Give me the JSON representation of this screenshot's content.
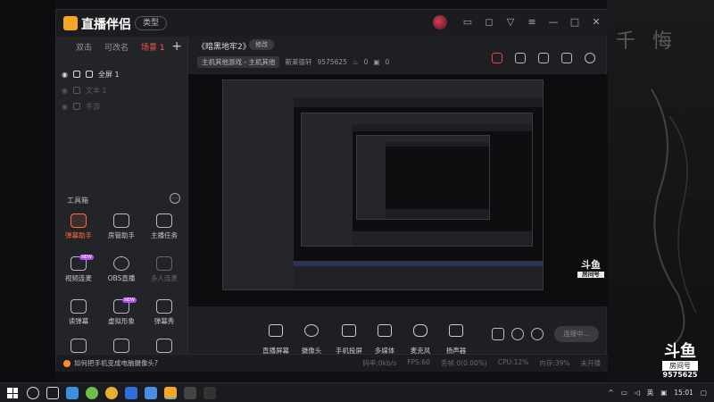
{
  "app": {
    "logo_text": "直播伴侣",
    "type_badge": "类型"
  },
  "window_controls": [
    "message-icon",
    "feedback-icon",
    "skin-icon",
    "menu-icon",
    "minimize-icon",
    "maximize-icon",
    "close-icon"
  ],
  "scene_tabs": [
    {
      "label": "双击",
      "active": false
    },
    {
      "label": "可改名",
      "active": false
    },
    {
      "label": "场景 1",
      "active": true
    }
  ],
  "sources": [
    {
      "label": "全屏 1",
      "dim": false
    },
    {
      "label": "文本 1",
      "dim": true
    },
    {
      "label": "手游",
      "dim": true
    }
  ],
  "tools": {
    "title": "工具箱",
    "items": [
      {
        "label": "弹幕助手",
        "icon": "danmaku-assistant-icon",
        "active": true
      },
      {
        "label": "房管助手",
        "icon": "room-admin-icon",
        "active": false
      },
      {
        "label": "主播任务",
        "icon": "streamer-task-icon",
        "active": false
      },
      {
        "label": "视频连麦",
        "icon": "video-link-icon",
        "active": false,
        "badge": "NEW"
      },
      {
        "label": "OBS直播",
        "icon": "obs-icon",
        "active": false
      },
      {
        "label": "多人连麦",
        "icon": "multi-link-icon",
        "active": false,
        "dim": true
      },
      {
        "label": "读弹幕",
        "icon": "read-danmaku-icon",
        "active": false
      },
      {
        "label": "虚拟形象",
        "icon": "avatar-icon",
        "active": false,
        "badge": "NEW"
      },
      {
        "label": "弹幕秀",
        "icon": "danmaku-show-icon",
        "active": false
      },
      {
        "label": "",
        "icon": "screen-icon",
        "active": false
      },
      {
        "label": "",
        "icon": "gift-icon",
        "active": false
      },
      {
        "label": "",
        "icon": "download-icon",
        "active": false
      }
    ]
  },
  "room": {
    "title": "《暗黑地牢2》",
    "edit_label": "修改",
    "category": "主机其他游戏 - 主机其他",
    "owner": "斯莱德轩",
    "room_id": "9575625",
    "hot": "0",
    "followers": "0"
  },
  "bottom_tools": [
    {
      "label": "直播屏幕",
      "icon": "screen-share-icon"
    },
    {
      "label": "摄像头",
      "icon": "camera-icon"
    },
    {
      "label": "手机投屏",
      "icon": "phone-cast-icon"
    },
    {
      "label": "多媒体",
      "icon": "media-icon"
    },
    {
      "label": "麦克风",
      "icon": "microphone-icon"
    },
    {
      "label": "扬声器",
      "icon": "speaker-icon"
    }
  ],
  "live_button": "连接中...",
  "status": {
    "tip": "如何把手机变成电脑摄像头?",
    "bitrate": "码率:0kb/s",
    "fps": "FPS:60",
    "drop": "丢帧:0(0.00%)",
    "cpu": "CPU:12%",
    "mem": "内存:39%",
    "state": "未开播"
  },
  "watermark": {
    "logo": "斗鱼",
    "room_label": "房间号",
    "room_id": "9575625"
  },
  "desktop_text": "千 悔",
  "taskbar": {
    "lang": "英",
    "time": "15:01"
  }
}
